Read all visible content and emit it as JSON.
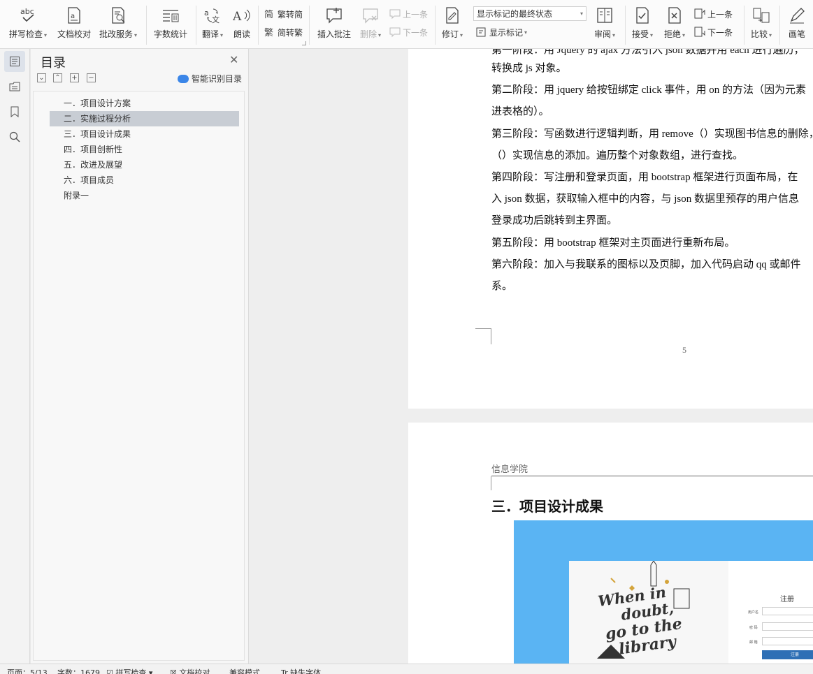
{
  "ribbon": {
    "buttons": [
      {
        "label": "拼写检查",
        "icon": "spellcheck-icon",
        "dropdown": true
      },
      {
        "label": "文档校对",
        "icon": "proofread-icon",
        "dropdown": false
      },
      {
        "label": "批改服务",
        "icon": "correction-service-icon",
        "dropdown": true
      },
      {
        "label": "字数统计",
        "icon": "word-count-icon",
        "dropdown": false
      },
      {
        "label": "翻译",
        "icon": "translate-icon",
        "dropdown": true
      },
      {
        "label": "朗读",
        "icon": "read-aloud-icon",
        "dropdown": false
      },
      {
        "label": "插入批注",
        "icon": "insert-comment-icon",
        "dropdown": false
      },
      {
        "label": "删除",
        "icon": "delete-comment-icon",
        "dropdown": true
      },
      {
        "label": "修订",
        "icon": "track-changes-icon",
        "dropdown": true
      },
      {
        "label": "审阅",
        "icon": "review-pane-icon",
        "dropdown": true
      },
      {
        "label": "接受",
        "icon": "accept-icon",
        "dropdown": true
      },
      {
        "label": "拒绝",
        "icon": "reject-icon",
        "dropdown": true
      },
      {
        "label": "比较",
        "icon": "compare-icon",
        "dropdown": true
      },
      {
        "label": "画笔",
        "icon": "pen-icon",
        "dropdown": false
      }
    ],
    "trad_to_simp": "繁转简",
    "simp_to_trad": "简转繁",
    "prev_comment": "上一条",
    "next_comment": "下一条",
    "markup_select": "显示标记的最终状态",
    "show_markup": "显示标记",
    "prev_change": "上一条",
    "next_change": "下一条"
  },
  "nav": {
    "title": "目录",
    "smart_toc": "智能识别目录",
    "items": [
      {
        "label": "一．项目设计方案",
        "selected": false
      },
      {
        "label": "二．实施过程分析",
        "selected": true
      },
      {
        "label": "三．项目设计成果",
        "selected": false
      },
      {
        "label": "四．项目创新性",
        "selected": false
      },
      {
        "label": "五．改进及展望",
        "selected": false
      },
      {
        "label": "六．项目成员",
        "selected": false
      },
      {
        "label": "附录一",
        "selected": false
      }
    ]
  },
  "document": {
    "lines": [
      "第一阶段：用 Jquery 的 ajax 方法引入 json 数据并用 each 进行遍历，",
      "转换成 js 对象。",
      "第二阶段：用 jquery 给按钮绑定 click 事件，用 on 的方法（因为元素",
      "进表格的）。",
      "第三阶段：写函数进行逻辑判断，用 remove（）实现图书信息的删除，",
      "（）实现信息的添加。遍历整个对象数组，进行查找。",
      "第四阶段：写注册和登录页面，用 bootstrap 框架进行页面布局，在",
      "入 json 数据，获取输入框中的内容，与 json 数据里预存的用户信息",
      "登录成功后跳转到主界面。",
      "第五阶段：用 bootstrap 框架对主页面进行重新布局。",
      "第六阶段：加入与我联系的图标以及页脚，加入代码启动 qq 或邮件",
      "系。"
    ],
    "page_number": "5",
    "header": "信息学院",
    "heading": "三．项目设计成果",
    "figure": {
      "quote_lines": [
        "When in",
        "doubt,",
        "go to the",
        "library"
      ],
      "register_title": "注册",
      "form_labels": [
        "用户名",
        "密 码",
        "邮 箱"
      ],
      "submit": "注册",
      "bg_color": "#5ab4f3"
    }
  },
  "status": {
    "page": "页面：5/13",
    "words": "字数：1679",
    "spell": "拼写检查",
    "proof": "文档校对",
    "compat": "兼容模式",
    "missing_font": "缺失字体"
  }
}
